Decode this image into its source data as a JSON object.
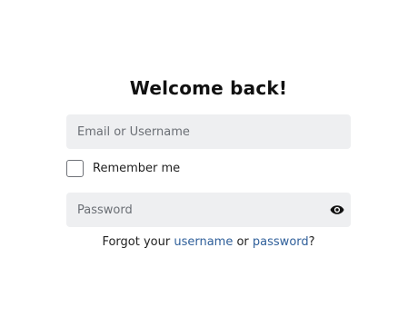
{
  "login": {
    "title": "Welcome back!",
    "email_placeholder": "Email or Username",
    "email_value": "",
    "remember_label": "Remember me",
    "remember_checked": false,
    "password_placeholder": "Password",
    "password_value": "",
    "show_password_icon": "eye-icon",
    "forgot": {
      "prefix": "Forgot your",
      "username_link": "username",
      "middle": "or",
      "password_link": "password",
      "suffix": "?"
    }
  },
  "colors": {
    "field_background": "#eeeff1",
    "link": "#2f5f9a",
    "title": "#111111"
  }
}
